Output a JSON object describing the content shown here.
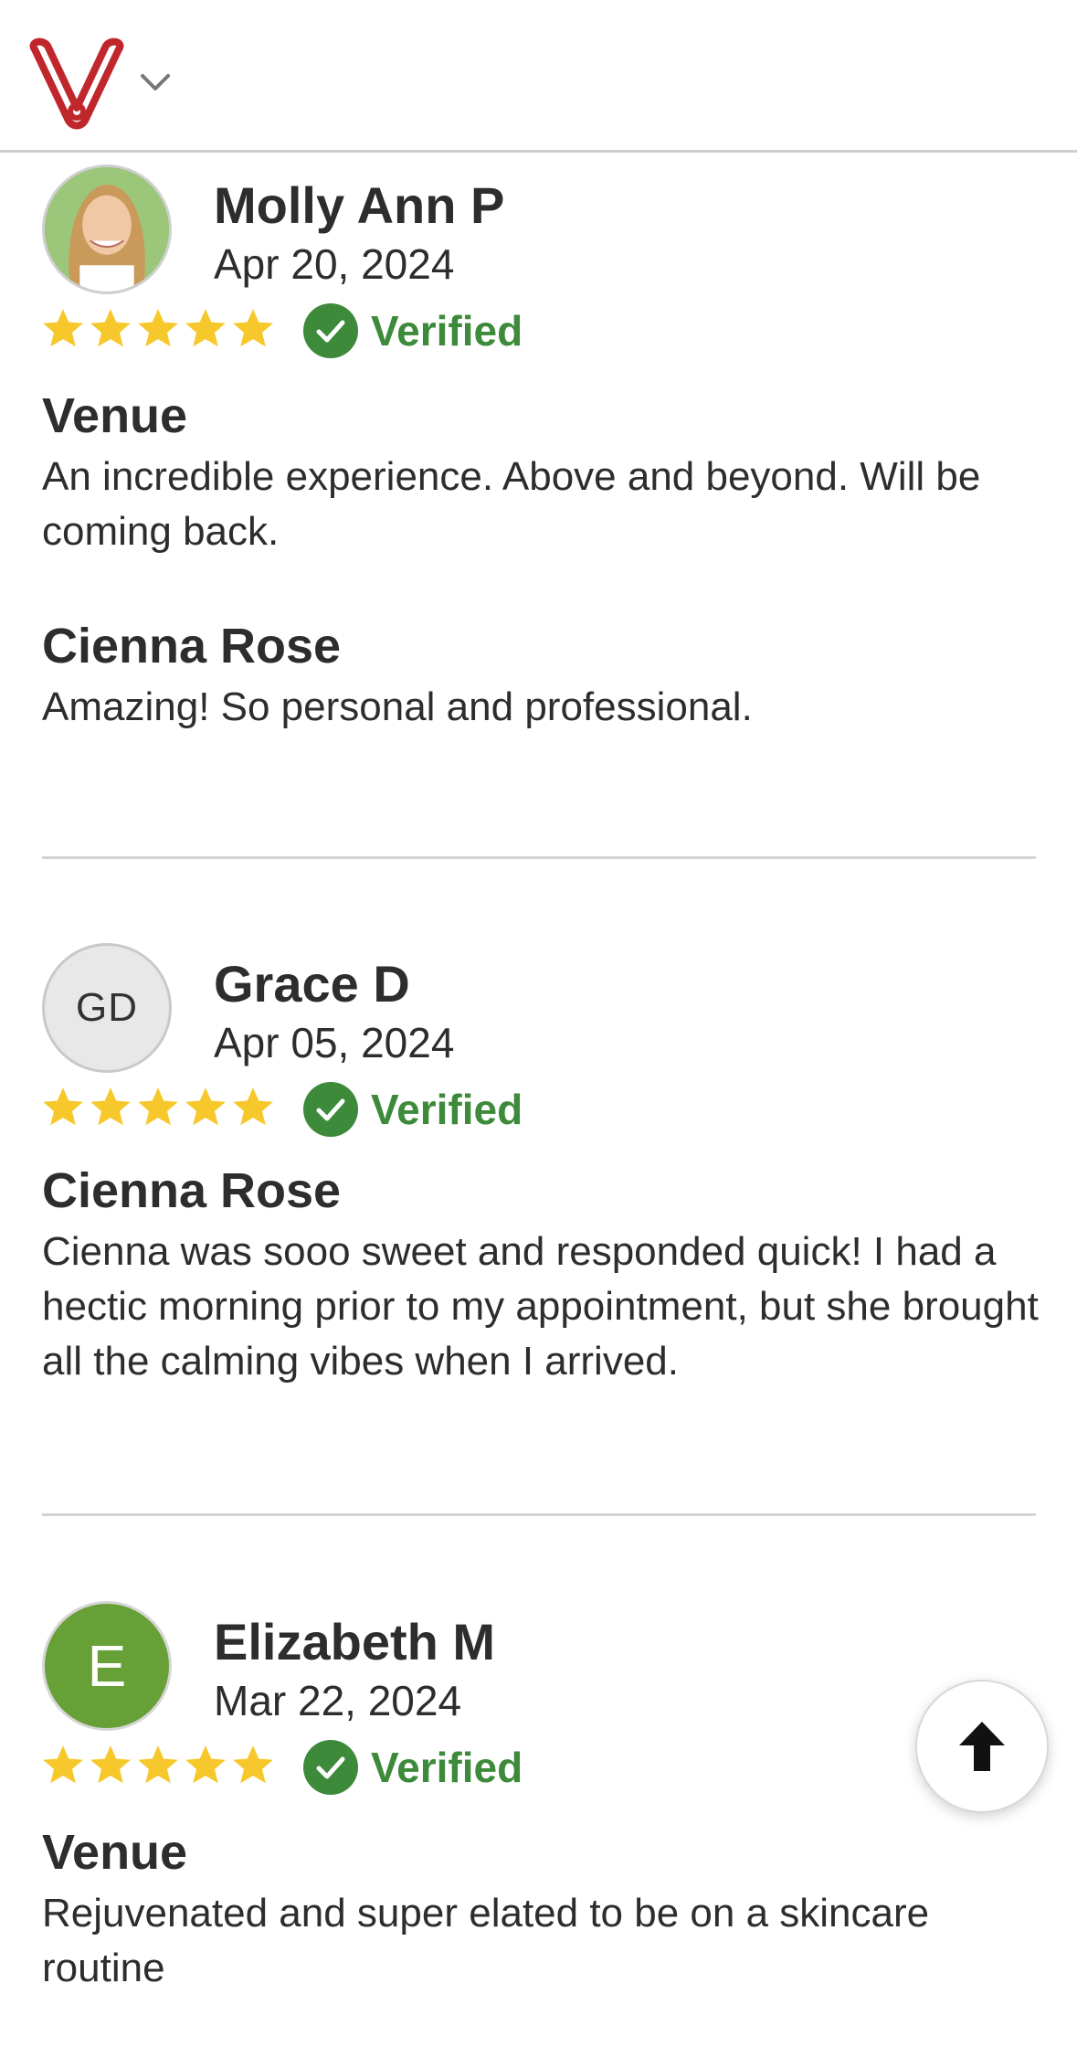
{
  "header": {
    "logo_icon": "vagaro-v-logo",
    "menu_icon": "chevron-down-icon"
  },
  "colors": {
    "brand": "#c0272d",
    "verified": "#3c8a3a",
    "star": "#f6c82b"
  },
  "reviews": [
    {
      "avatar_type": "photo",
      "avatar_initials": "",
      "name": "Molly Ann P",
      "date": "Apr 20, 2024",
      "rating": 5,
      "verified_label": "Verified",
      "sections": [
        {
          "title": "Venue",
          "body": "An incredible experience. Above and beyond. Will be coming back."
        },
        {
          "title": "Cienna Rose",
          "body": "Amazing! So personal and professional."
        }
      ]
    },
    {
      "avatar_type": "initials",
      "avatar_initials": "GD",
      "name": "Grace D",
      "date": "Apr 05, 2024",
      "rating": 5,
      "verified_label": "Verified",
      "sections": [
        {
          "title": "Cienna Rose",
          "body": "Cienna was sooo sweet and responded quick! I had a hectic morning prior to my appointment, but she brought all the calming vibes when I arrived."
        }
      ]
    },
    {
      "avatar_type": "initials",
      "avatar_initials": "E",
      "name": "Elizabeth M",
      "date": "Mar 22, 2024",
      "rating": 5,
      "verified_label": "Verified",
      "sections": [
        {
          "title": "Venue",
          "body": "Rejuvenated and super elated to be on a skincare routine"
        }
      ]
    }
  ],
  "scroll_top_button": {
    "icon": "arrow-up-icon"
  }
}
